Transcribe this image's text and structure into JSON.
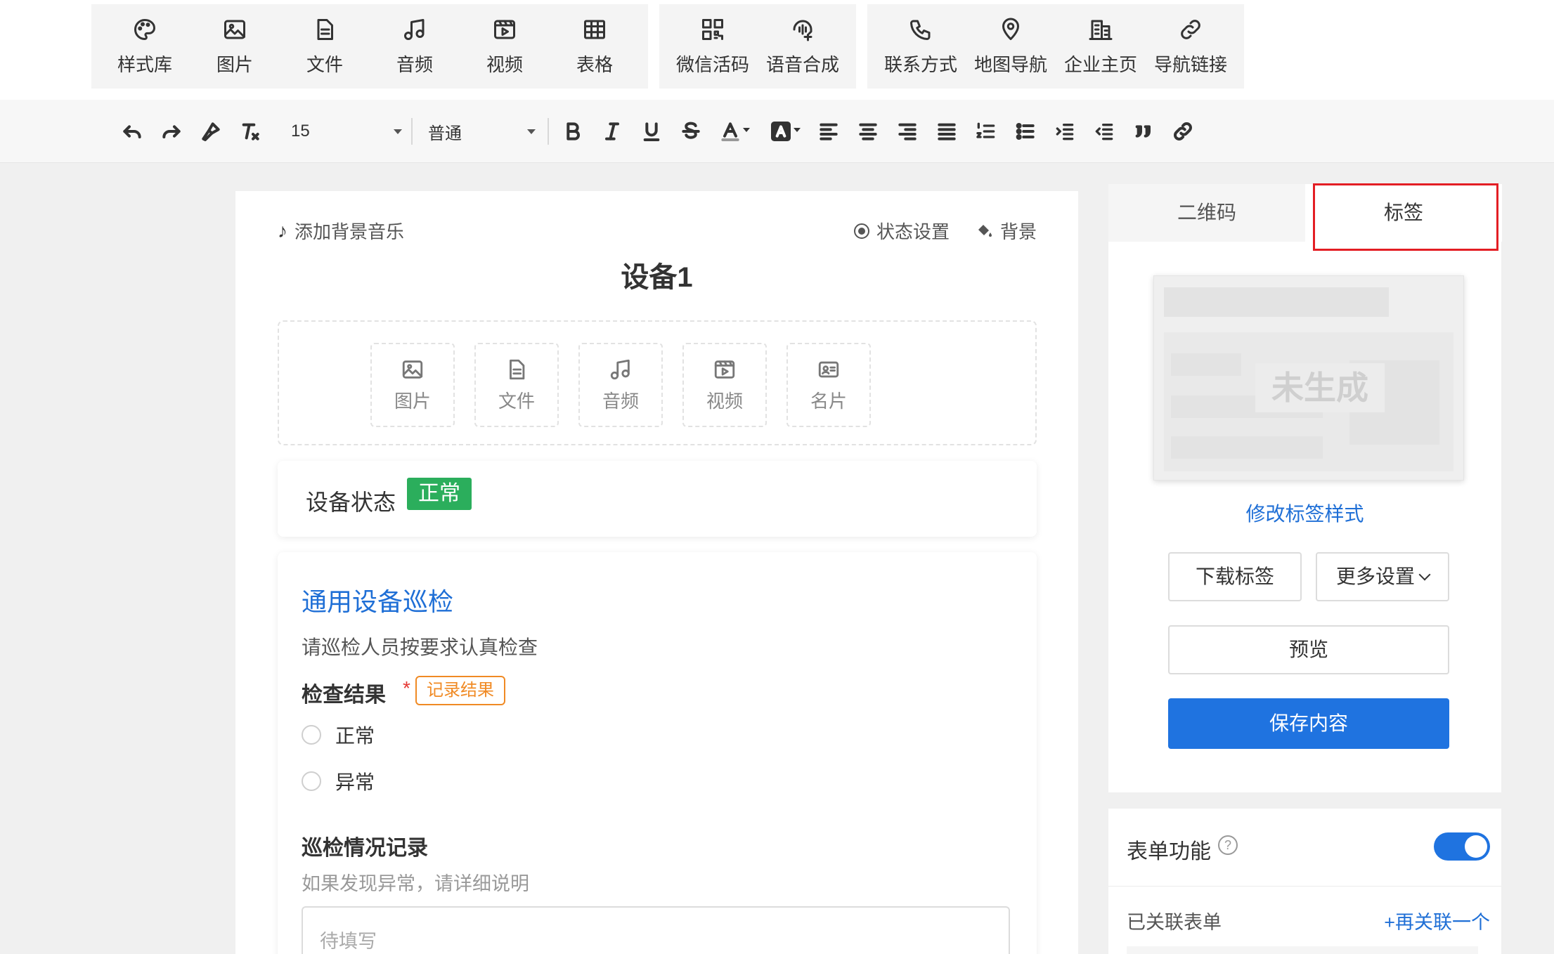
{
  "insert_toolbar": {
    "groups": [
      {
        "items": [
          {
            "label": "样式库",
            "icon": "palette-icon"
          },
          {
            "label": "图片",
            "icon": "image-icon"
          },
          {
            "label": "文件",
            "icon": "file-icon"
          },
          {
            "label": "音频",
            "icon": "music-icon"
          },
          {
            "label": "视频",
            "icon": "video-icon"
          },
          {
            "label": "表格",
            "icon": "table-icon"
          }
        ]
      },
      {
        "items": [
          {
            "label": "微信活码",
            "icon": "qr-code-icon"
          },
          {
            "label": "语音合成",
            "icon": "voice-synthesis-icon"
          }
        ]
      },
      {
        "items": [
          {
            "label": "联系方式",
            "icon": "phone-icon"
          },
          {
            "label": "地图导航",
            "icon": "map-pin-icon"
          },
          {
            "label": "企业主页",
            "icon": "building-icon"
          },
          {
            "label": "导航链接",
            "icon": "link-icon"
          }
        ]
      }
    ]
  },
  "format_toolbar": {
    "font_size": "15",
    "paragraph_style": "普通",
    "tools": [
      "undo-icon",
      "redo-icon",
      "format-painter-icon",
      "clear-format-icon",
      "bold-icon",
      "italic-icon",
      "underline-icon",
      "strikethrough-icon",
      "font-color-icon",
      "highlight-color-icon",
      "align-left-icon",
      "align-center-icon",
      "align-right-icon",
      "justify-icon",
      "ordered-list-icon",
      "bullet-list-icon",
      "indent-icon",
      "outdent-icon",
      "quote-icon",
      "link-icon"
    ]
  },
  "editor": {
    "bg_music": "添加背景音乐",
    "status_settings": "状态设置",
    "background": "背景",
    "title": "设备1",
    "media_buttons": [
      {
        "label": "图片",
        "icon": "image-icon"
      },
      {
        "label": "文件",
        "icon": "file-icon"
      },
      {
        "label": "音频",
        "icon": "music-icon"
      },
      {
        "label": "视频",
        "icon": "video-icon"
      },
      {
        "label": "名片",
        "icon": "business-card-icon"
      }
    ],
    "status": {
      "label": "设备状态",
      "value": "正常",
      "color": "#2bae5c"
    },
    "form": {
      "title": "通用设备巡检",
      "description": "请巡检人员按要求认真检查",
      "question1": {
        "label": "检查结果",
        "required_mark": "*",
        "tag": "记录结果",
        "options": [
          "正常",
          "异常"
        ]
      },
      "question2": {
        "label": "巡检情况记录",
        "hint": "如果发现异常，请详细说明",
        "placeholder": "待填写"
      }
    }
  },
  "right_panel": {
    "tabs": [
      {
        "label": "二维码",
        "active": false
      },
      {
        "label": "标签",
        "active": true
      }
    ],
    "preview_text": "未生成",
    "edit_style": "修改标签样式",
    "download": "下载标签",
    "more_settings": "更多设置",
    "preview": "预览",
    "save": "保存内容",
    "form_function": {
      "label": "表单功能",
      "help": "?",
      "enabled": true
    },
    "linked_form": {
      "label": "已关联表单",
      "action": "+再关联一个"
    }
  },
  "colors": {
    "accent": "#1f73e0",
    "link": "#1f6fd6",
    "success": "#2bae5c",
    "warning": "#f08a24",
    "highlight_box": "#e31e24"
  }
}
